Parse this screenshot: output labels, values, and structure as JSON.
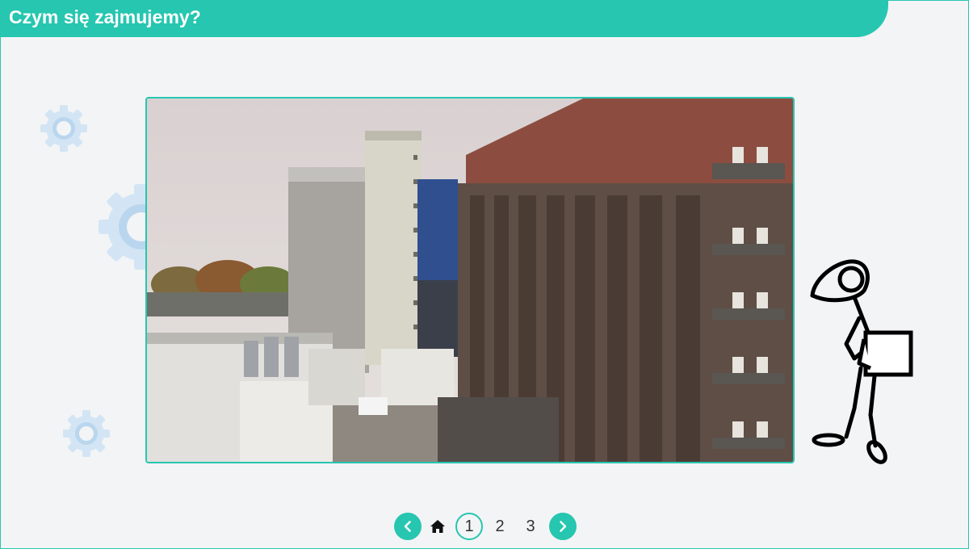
{
  "header": {
    "title": "Czym się zajmujemy?"
  },
  "colors": {
    "accent": "#26c6b0",
    "background": "#f3f4f6",
    "gear": "#cfe3f3"
  },
  "media": {
    "icon": "factory-photo"
  },
  "pagination": {
    "prev_icon": "chevron-left-icon",
    "home_icon": "home-icon",
    "next_icon": "chevron-right-icon",
    "pages": [
      "1",
      "2",
      "3"
    ],
    "active_page": "1"
  }
}
